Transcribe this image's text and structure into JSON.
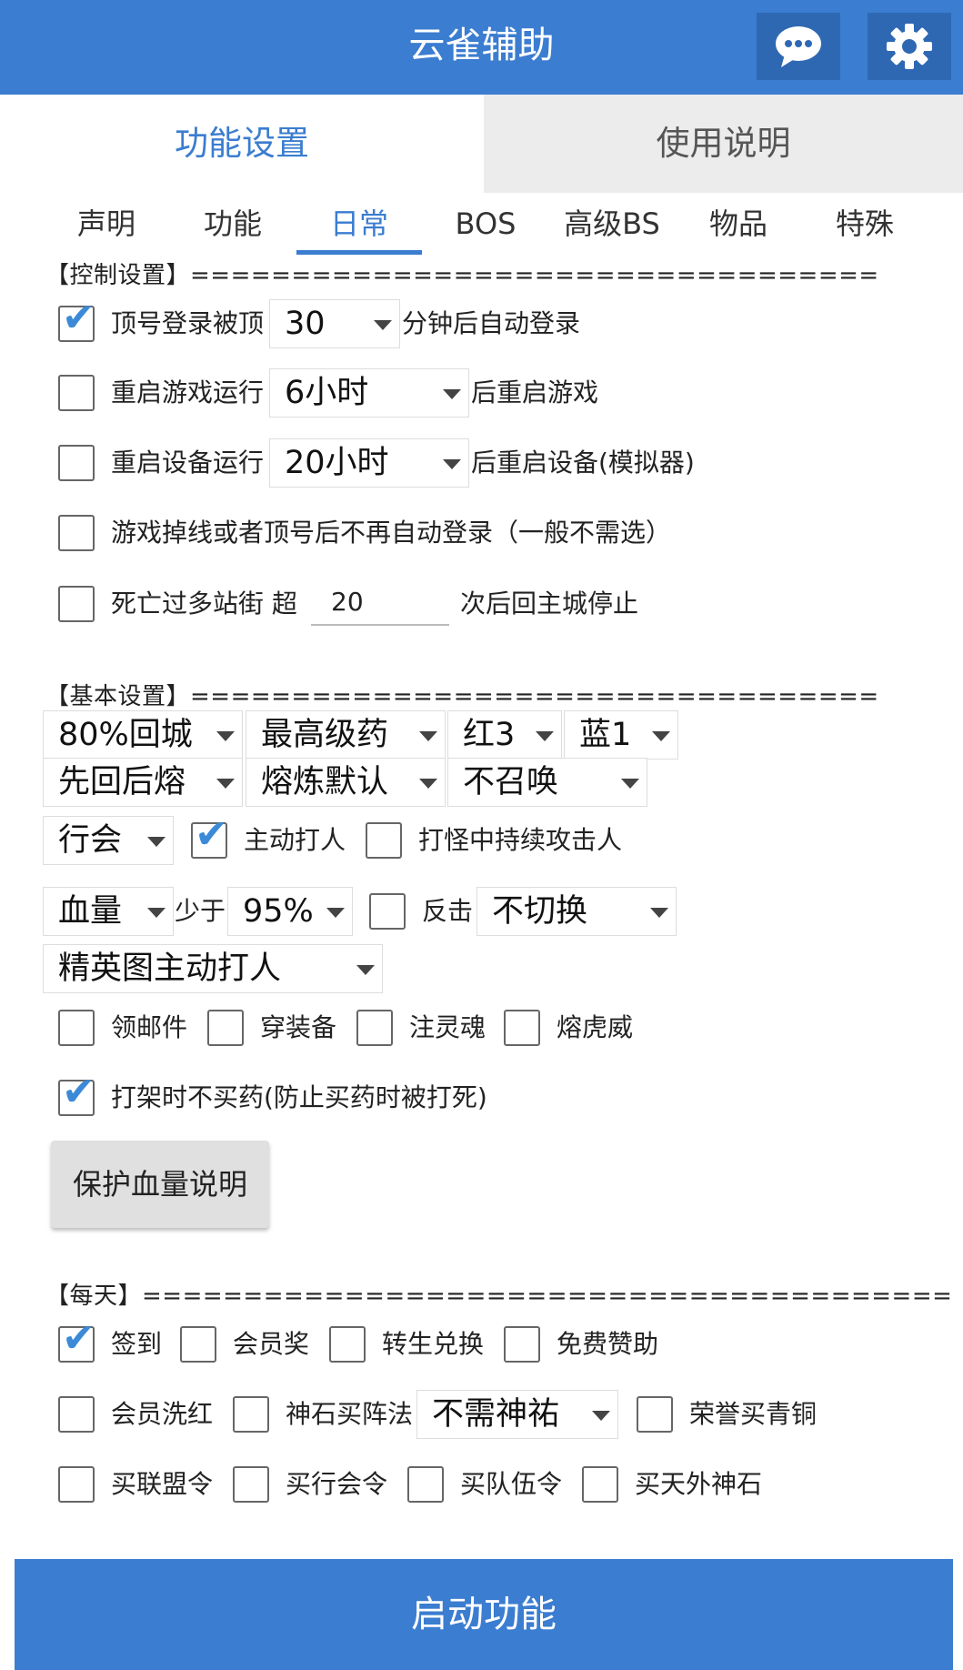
{
  "header": {
    "title": "云雀辅助",
    "chat_icon": "chat-icon",
    "settings_icon": "gear-icon"
  },
  "main_tabs": [
    {
      "label": "功能设置",
      "active": true
    },
    {
      "label": "使用说明",
      "active": false
    }
  ],
  "sub_tabs": [
    {
      "label": "声明"
    },
    {
      "label": "功能"
    },
    {
      "label": "日常",
      "active": true
    },
    {
      "label": "BOS"
    },
    {
      "label": "高级BS"
    },
    {
      "label": "物品"
    },
    {
      "label": "特殊"
    }
  ],
  "control": {
    "header": "【控制设置】==================================",
    "top_login": {
      "checked": true,
      "label": "顶号登录被顶",
      "value": "30",
      "suffix": "分钟后自动登录"
    },
    "restart_game": {
      "checked": false,
      "label": "重启游戏运行",
      "value": "6小时",
      "suffix": "后重启游戏"
    },
    "restart_device": {
      "checked": false,
      "label": "重启设备运行",
      "value": "20小时",
      "suffix": "后重启设备(模拟器)"
    },
    "no_relogin": {
      "checked": false,
      "label": "游戏掉线或者顶号后不再自动登录（一般不需选）"
    },
    "death": {
      "checked": false,
      "label": "死亡过多站街 超",
      "value": "20",
      "suffix": "次后回主城停止"
    }
  },
  "basic": {
    "header": "【基本设置】==================================",
    "row1": [
      "80%回城",
      "最高级药",
      "红3",
      "蓝1"
    ],
    "row2": [
      "先回后熔",
      "熔炼默认",
      "不召唤"
    ],
    "guild": "行会",
    "active_attack": {
      "checked": true,
      "label": "主动打人"
    },
    "keep_attack": {
      "checked": false,
      "label": "打怪中持续攻击人"
    },
    "hp_select": "血量",
    "less_than": "少于",
    "hp_value": "95%",
    "counter": {
      "checked": false,
      "label": "反击"
    },
    "switch_value": "不切换",
    "elite": "精英图主动打人",
    "mail": {
      "checked": false,
      "label": "领邮件"
    },
    "equip": {
      "checked": false,
      "label": "穿装备"
    },
    "soul": {
      "checked": false,
      "label": "注灵魂"
    },
    "tiger": {
      "checked": false,
      "label": "熔虎威"
    },
    "no_buy_drug": {
      "checked": true,
      "label": "打架时不买药(防止买药时被打死)"
    },
    "protect_btn": "保护血量说明"
  },
  "daily": {
    "header": "【每天】========================================",
    "sign": {
      "checked": true,
      "label": "签到"
    },
    "vip_reward": {
      "checked": false,
      "label": "会员奖"
    },
    "rebirth": {
      "checked": false,
      "label": "转生兑换"
    },
    "free_help": {
      "checked": false,
      "label": "免费赞助"
    },
    "vip_wash": {
      "checked": false,
      "label": "会员洗红"
    },
    "stone_formation": {
      "checked": false,
      "label": "神石买阵法"
    },
    "blessing": "不需神祐",
    "honor_bronze": {
      "checked": false,
      "label": "荣誉买青铜"
    },
    "alliance": {
      "checked": false,
      "label": "买联盟令"
    },
    "guild_order": {
      "checked": false,
      "label": "买行会令"
    },
    "team_order": {
      "checked": false,
      "label": "买队伍令"
    },
    "sky_stone": {
      "checked": false,
      "label": "买天外神石"
    }
  },
  "start_button": "启动功能"
}
